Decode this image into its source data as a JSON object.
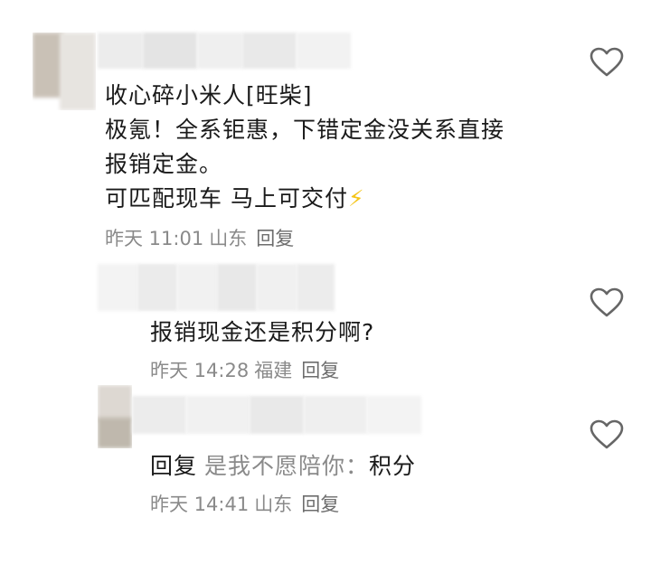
{
  "comments": [
    {
      "author": "收心碎小米人[旺柴]",
      "lines": [
        "极氪！全系钜惠，下错定金没关系直接",
        "报销定金。",
        "可匹配现车 马上可交付"
      ],
      "emoji": "⚡",
      "time": "昨天 11:01",
      "location": "山东",
      "reply_label": "回复"
    },
    {
      "text": "报销现金还是积分啊?",
      "time": "昨天 14:28",
      "location": "福建",
      "reply_label": "回复"
    },
    {
      "reply_prefix": "回复",
      "reply_to": "是我不愿陪你：",
      "text": "积分",
      "time": "昨天 14:41",
      "location": "山东",
      "reply_label": "回复"
    }
  ],
  "icons": {
    "like": "heart-outline-icon",
    "emoji": "lightning-bolt"
  },
  "colors": {
    "text": "#1a1a1a",
    "meta": "#8a8a8a",
    "icon": "#666666",
    "bolt": "#f5c518"
  }
}
